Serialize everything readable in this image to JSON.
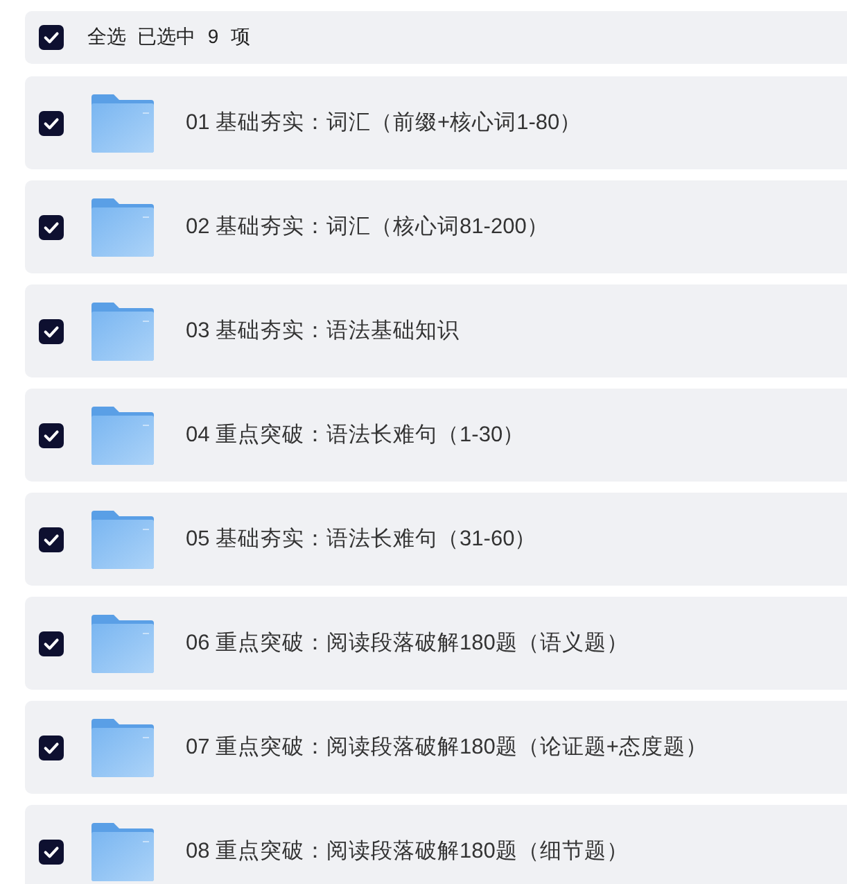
{
  "header": {
    "checked": true,
    "label": "全选",
    "status": "已选中 9 项"
  },
  "items": [
    {
      "kind": "folder",
      "checked": true,
      "name": "01 基础夯实：词汇（前缀+核心词1-80）"
    },
    {
      "kind": "folder",
      "checked": true,
      "name": "02 基础夯实：词汇（核心词81-200）"
    },
    {
      "kind": "folder",
      "checked": true,
      "name": "03 基础夯实：语法基础知识"
    },
    {
      "kind": "folder",
      "checked": true,
      "name": "04 重点突破：语法长难句（1-30）"
    },
    {
      "kind": "folder",
      "checked": true,
      "name": "05 基础夯实：语法长难句（31-60）"
    },
    {
      "kind": "folder",
      "checked": true,
      "name": "06 重点突破：阅读段落破解180题（语义题）"
    },
    {
      "kind": "folder",
      "checked": true,
      "name": "07 重点突破：阅读段落破解180题（论证题+态度题）"
    },
    {
      "kind": "folder",
      "checked": true,
      "name": "08 重点突破：阅读段落破解180题（细节题）"
    }
  ]
}
